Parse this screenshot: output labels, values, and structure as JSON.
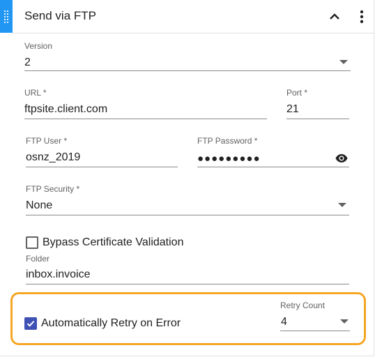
{
  "header": {
    "title": "Send via FTP"
  },
  "fields": {
    "version": {
      "label": "Version",
      "value": "2"
    },
    "url": {
      "label": "URL *",
      "value": "ftpsite.client.com"
    },
    "port": {
      "label": "Port *",
      "value": "21"
    },
    "ftp_user": {
      "label": "FTP User *",
      "value": "osnz_2019"
    },
    "ftp_password": {
      "label": "FTP Password *",
      "value": "●●●●●●●●●"
    },
    "ftp_security": {
      "label": "FTP Security *",
      "value": "None"
    },
    "bypass_cert": {
      "label": "Bypass Certificate Validation",
      "checked": false
    },
    "folder": {
      "label": "Folder",
      "value": "inbox.invoice"
    },
    "auto_retry": {
      "label": "Automatically Retry on Error",
      "checked": true
    },
    "retry_count": {
      "label": "Retry Count",
      "value": "4"
    }
  },
  "icons": {
    "drag": "drag-handle-icon",
    "collapse": "chevron-up-icon",
    "menu": "more-vertical-icon",
    "visibility": "eye-icon",
    "dropdown": "arrow-drop-down-icon"
  },
  "colors": {
    "accent": "#2196f3",
    "checkbox": "#3f51b5",
    "highlight": "#f5a623"
  }
}
